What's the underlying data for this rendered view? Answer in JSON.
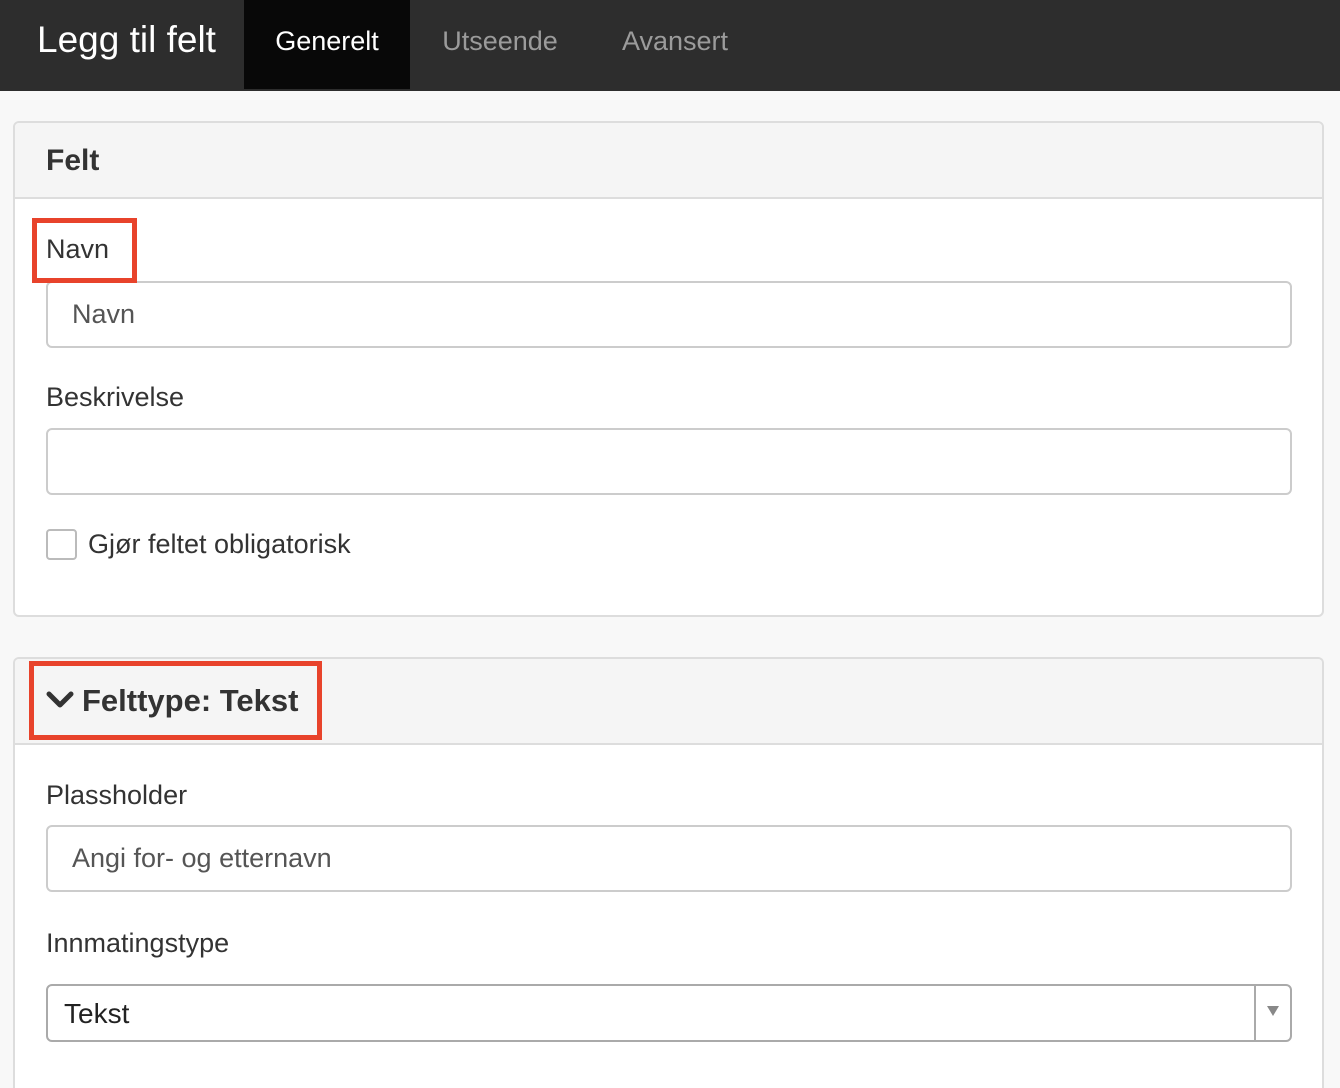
{
  "header": {
    "title": "Legg til felt",
    "tabs": [
      {
        "label": "Generelt",
        "active": true
      },
      {
        "label": "Utseende",
        "active": false
      },
      {
        "label": "Avansert",
        "active": false
      }
    ]
  },
  "felt_panel": {
    "title": "Felt",
    "name_label": "Navn",
    "name_value": "Navn",
    "description_label": "Beskrivelse",
    "description_value": "",
    "required_checkbox_label": "Gjør feltet obligatorisk",
    "required_checked": false
  },
  "felttype_panel": {
    "title": "Felttype: Tekst",
    "placeholder_label": "Plassholder",
    "placeholder_value": "Angi for- og etternavn",
    "input_type_label": "Innmatingstype",
    "input_type_value": "Tekst"
  },
  "colors": {
    "topbar": "#2d2d2d",
    "active_tab": "#080808",
    "highlight": "#e8432b"
  }
}
